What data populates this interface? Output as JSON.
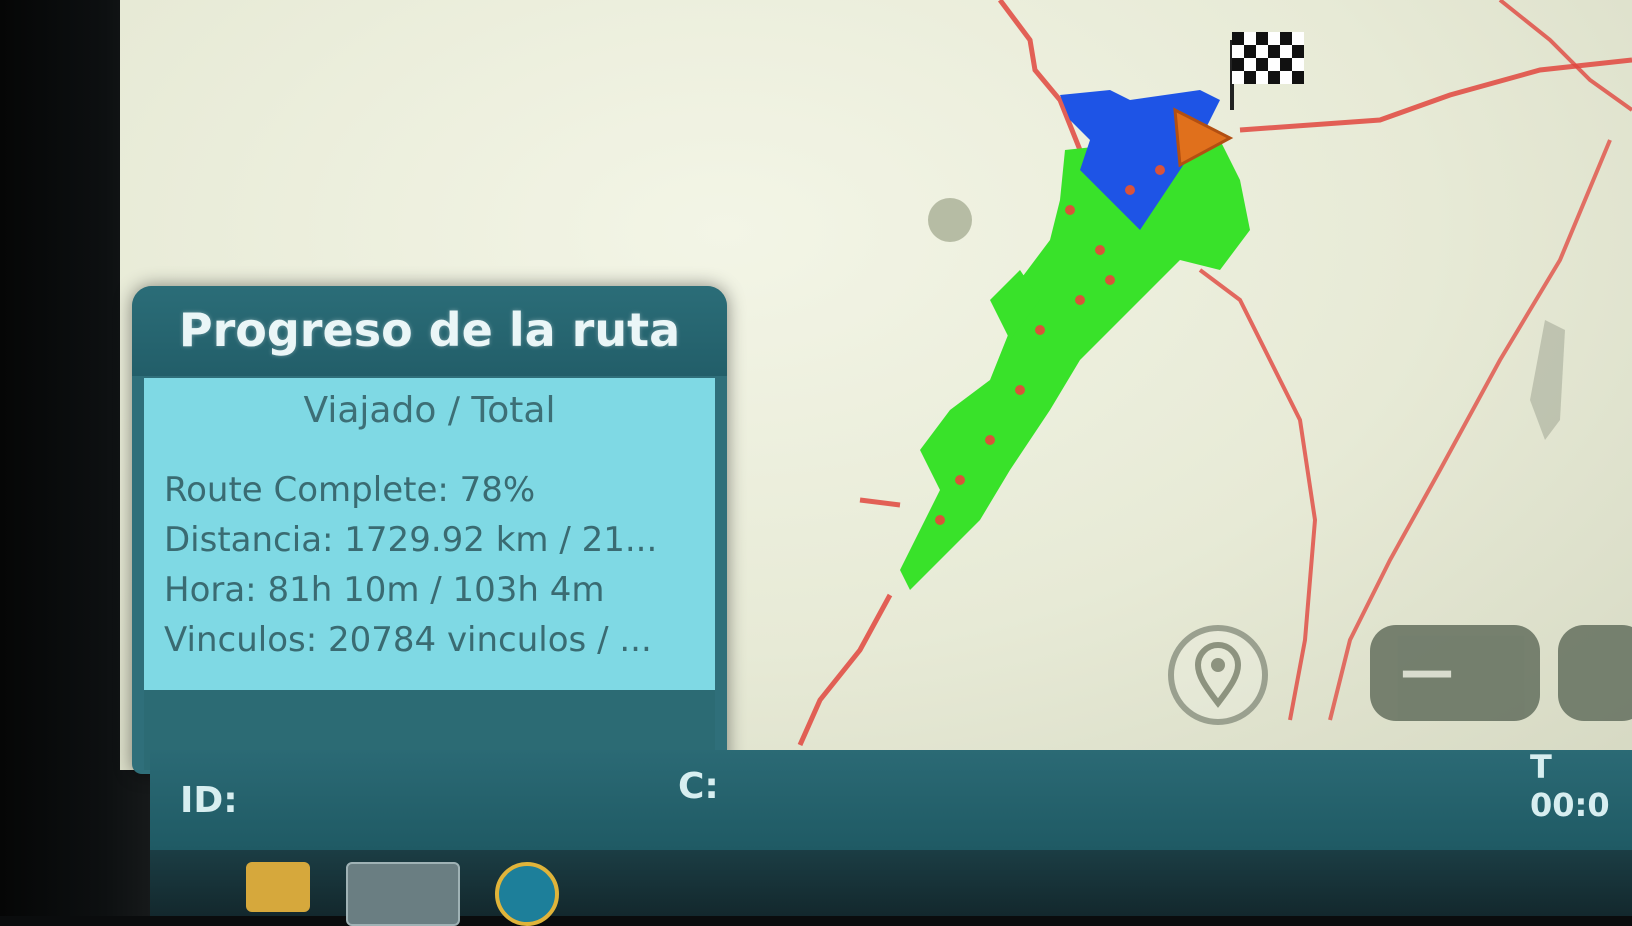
{
  "panel": {
    "title": "Progreso de la ruta",
    "subtitle": "Viajado / Total",
    "route_complete": "Route Complete: 78%",
    "distance": "Distancia: 1729.92 km / 21...",
    "time": "Hora: 81h 10m / 103h 4m",
    "links": "Vinculos: 20784 vinculos / ..."
  },
  "status_bar": {
    "id_label": "ID:",
    "c_label": "C:",
    "time_label": "T 00:0"
  },
  "map": {
    "zoom_out_label": "—",
    "colors": {
      "traveled_route": "#39e22a",
      "recent_route": "#1e54e6",
      "road": "#e0463e",
      "position_marker": "#e0701c"
    },
    "icons": [
      "finish-flag-icon",
      "position-arrow-icon",
      "locate-pin-icon"
    ]
  },
  "taskbar": {
    "icons": [
      "folder-icon",
      "window-icon",
      "browser-icon"
    ]
  }
}
